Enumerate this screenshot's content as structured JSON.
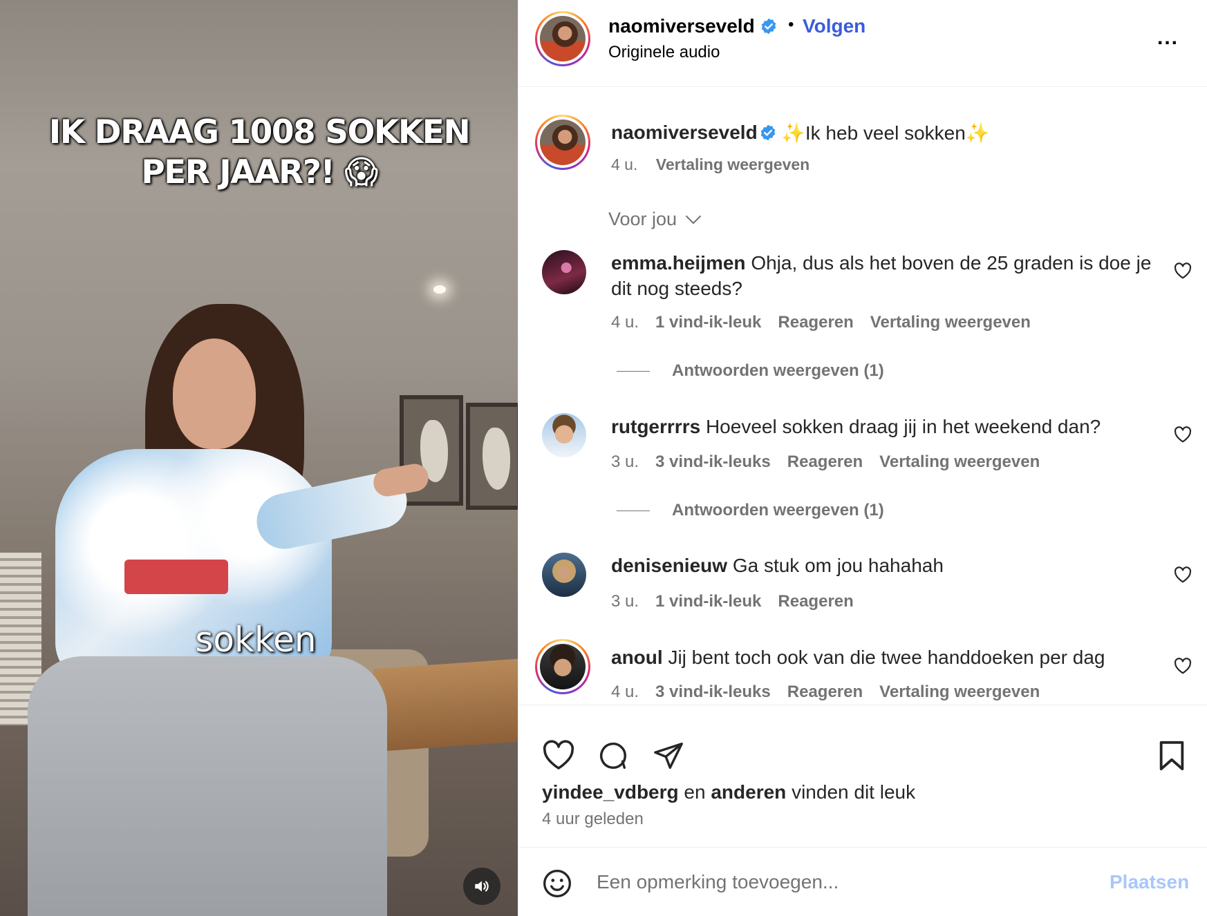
{
  "video": {
    "title_line1": "IK DRAAG 1008 SOKKEN",
    "title_line2": "PER JAAR?! 😱",
    "caption": "sokken",
    "mute_icon": "speaker-icon"
  },
  "header": {
    "username": "naomiverseveld",
    "follow_label": "Volgen",
    "separator": "•",
    "audio": "Originele audio",
    "more_label": "..."
  },
  "caption": {
    "username": "naomiverseveld",
    "text": "✨Ik heb veel sokken✨",
    "time": "4 u.",
    "translate": "Vertaling weergeven"
  },
  "sort": {
    "label": "Voor jou"
  },
  "comments": [
    {
      "user": "emma.heijmen",
      "text": "Ohja, dus als het boven de 25 graden is doe je dit nog steeds?",
      "time": "4 u.",
      "likes": "1 vind-ik-leuk",
      "reply": "Reageren",
      "translate": "Vertaling weergeven",
      "replies": "Antwoorden weergeven (1)"
    },
    {
      "user": "rutgerrrrs",
      "text": "Hoeveel sokken draag jij in het weekend dan?",
      "time": "3 u.",
      "likes": "3 vind-ik-leuks",
      "reply": "Reageren",
      "translate": "Vertaling weergeven",
      "replies": "Antwoorden weergeven (1)"
    },
    {
      "user": "denisenieuw",
      "text": "Ga stuk om jou hahahah",
      "time": "3 u.",
      "likes": "1 vind-ik-leuk",
      "reply": "Reageren"
    },
    {
      "user": "anoul",
      "text": "Jij bent toch ook van die twee handdoeken per dag",
      "time": "4 u.",
      "likes": "3 vind-ik-leuks",
      "reply": "Reageren",
      "translate": "Vertaling weergeven"
    }
  ],
  "likes": {
    "user": "yindee_vdberg",
    "joiner": "en",
    "others": "anderen",
    "suffix": "vinden dit leuk"
  },
  "posted": "4 uur geleden",
  "composer": {
    "placeholder": "Een opmerking toevoegen...",
    "post_label": "Plaatsen"
  },
  "colors": {
    "follow": "#3b5bdb",
    "verified": "#3897f0",
    "muted_text": "#737373",
    "post_disabled": "#a8c7fa"
  }
}
